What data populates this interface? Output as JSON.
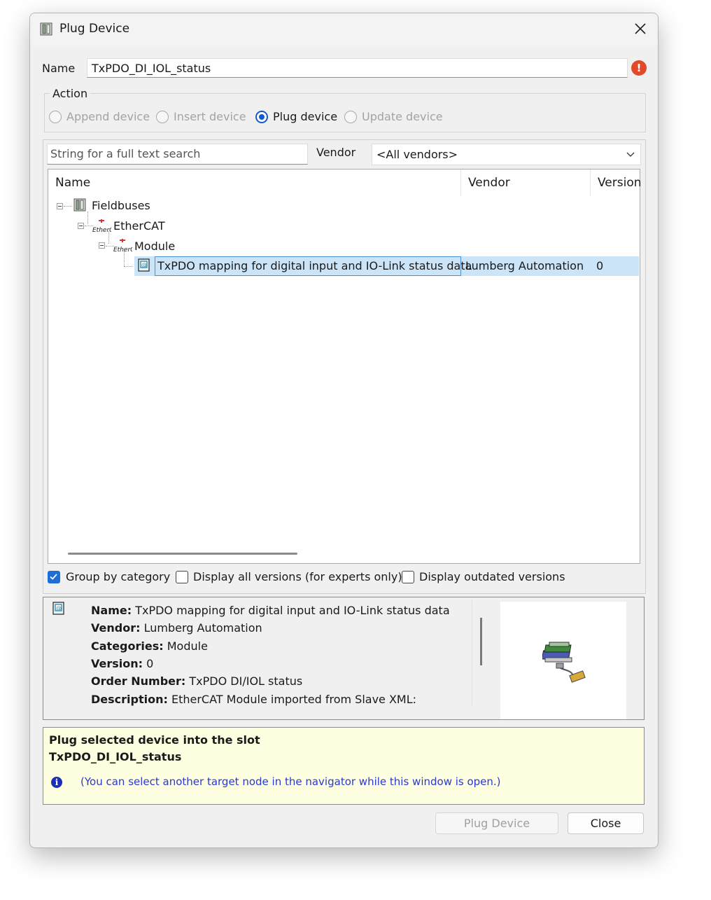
{
  "window": {
    "title": "Plug Device",
    "title_icon": "device-icon",
    "close_icon": "close-icon"
  },
  "name_field": {
    "label": "Name",
    "value": "TxPDO_DI_IOL_status",
    "status_icon": "error-icon"
  },
  "action": {
    "label": "Action",
    "options": [
      {
        "label": "Append device",
        "selected": false,
        "enabled": false
      },
      {
        "label": "Insert device",
        "selected": false,
        "enabled": false
      },
      {
        "label": "Plug device",
        "selected": true,
        "enabled": true
      },
      {
        "label": "Update device",
        "selected": false,
        "enabled": false
      }
    ]
  },
  "filter": {
    "search_placeholder": "String for a full text search",
    "vendor_label": "Vendor",
    "vendor_value": "<All vendors>"
  },
  "tree": {
    "columns": [
      "Name",
      "Vendor",
      "Version"
    ],
    "nodes": [
      {
        "label": "Fieldbuses",
        "icon": "fieldbus-icon",
        "level": 0
      },
      {
        "label": "EtherCAT",
        "icon": "ethercat-icon",
        "level": 1
      },
      {
        "label": "Module",
        "icon": "ethercat-icon",
        "level": 2
      },
      {
        "label": "TxPDO mapping for digital input and IO-Link status data",
        "vendor": "Lumberg Automation",
        "version": "0",
        "icon": "module-icon",
        "level": 3,
        "selected": true
      }
    ]
  },
  "options": {
    "group_by_category": {
      "label": "Group by category",
      "checked": true
    },
    "display_all_versions": {
      "label": "Display all versions (for experts only)",
      "checked": false
    },
    "display_outdated": {
      "label": "Display outdated versions",
      "checked": false
    }
  },
  "details": {
    "icon": "module-icon",
    "name_key": "Name:",
    "name_val": "TxPDO mapping for digital input and IO-Link status data",
    "vendor_key": "Vendor:",
    "vendor_val": "Lumberg Automation",
    "categories_key": "Categories:",
    "categories_val": "Module",
    "version_key": "Version:",
    "version_val": "0",
    "order_key": "Order Number:",
    "order_val": "TxPDO DI/IOL status",
    "description_key": "Description:",
    "description_val": "EtherCAT Module imported from Slave XML:",
    "preview_icon": "device-library-icon"
  },
  "message": {
    "line1": "Plug selected device into the slot",
    "line2": "TxPDO_DI_IOL_status",
    "info_icon": "info-icon",
    "hint": "(You can select another target node in the navigator while this window is open.)"
  },
  "buttons": {
    "plug": "Plug Device",
    "close": "Close"
  }
}
